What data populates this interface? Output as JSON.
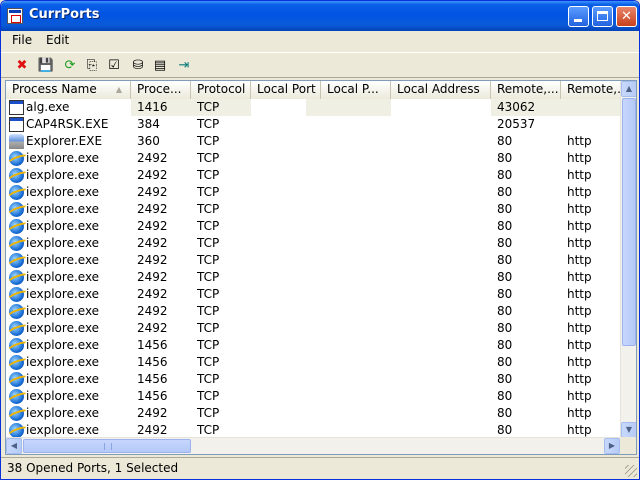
{
  "window": {
    "title": "CurrPorts",
    "app_icon": "currports-app-icon"
  },
  "title_buttons": {
    "minimize": "minimize-icon",
    "maximize": "maximize-icon",
    "close_label": "✕"
  },
  "menu": {
    "file": "File",
    "edit": "Edit"
  },
  "toolbar": {
    "items": [
      {
        "name": "close-connections-button",
        "icon": "red-x-icon",
        "glyph": "✖",
        "color": "#e01010"
      },
      {
        "name": "save-button",
        "icon": "floppy-disk-icon",
        "glyph": "💾",
        "color": "#000000"
      },
      {
        "name": "refresh-button",
        "icon": "refresh-icon",
        "glyph": "⟳",
        "color": "#1a9a1a"
      },
      {
        "name": "copy-button",
        "icon": "copy-icon",
        "glyph": "⎘",
        "color": "#000000"
      },
      {
        "name": "properties-button",
        "icon": "properties-icon",
        "glyph": "☑",
        "color": "#000000"
      },
      {
        "name": "find-button",
        "icon": "binoculars-icon",
        "glyph": "⛁",
        "color": "#000000"
      },
      {
        "name": "html-report-button",
        "icon": "report-icon",
        "glyph": "▤",
        "color": "#000000"
      },
      {
        "name": "exit-button",
        "icon": "exit-icon",
        "glyph": "⇥",
        "color": "#0a7a7a"
      }
    ]
  },
  "columns": [
    {
      "key": "process",
      "label": "Process Name",
      "sorted": true
    },
    {
      "key": "pid",
      "label": "Proce..."
    },
    {
      "key": "protocol",
      "label": "Protocol"
    },
    {
      "key": "local_port",
      "label": "Local Port"
    },
    {
      "key": "local_port_name",
      "label": "Local P..."
    },
    {
      "key": "local_address",
      "label": "Local Address"
    },
    {
      "key": "remote_port",
      "label": "Remote,..."
    },
    {
      "key": "remote_port_name",
      "label": "Remote,..."
    }
  ],
  "rows": [
    {
      "icon": "window",
      "process": "alg.exe",
      "pid": "1416",
      "protocol": "TCP",
      "remote_port": "43062",
      "remote_port_name": "",
      "selected": true
    },
    {
      "icon": "window",
      "process": "CAP4RSK.EXE",
      "pid": "384",
      "protocol": "TCP",
      "remote_port": "20537",
      "remote_port_name": ""
    },
    {
      "icon": "explorer",
      "process": "Explorer.EXE",
      "pid": "360",
      "protocol": "TCP",
      "remote_port": "80",
      "remote_port_name": "http"
    },
    {
      "icon": "ie",
      "process": "iexplore.exe",
      "pid": "2492",
      "protocol": "TCP",
      "remote_port": "80",
      "remote_port_name": "http"
    },
    {
      "icon": "ie",
      "process": "iexplore.exe",
      "pid": "2492",
      "protocol": "TCP",
      "remote_port": "80",
      "remote_port_name": "http"
    },
    {
      "icon": "ie",
      "process": "iexplore.exe",
      "pid": "2492",
      "protocol": "TCP",
      "remote_port": "80",
      "remote_port_name": "http"
    },
    {
      "icon": "ie",
      "process": "iexplore.exe",
      "pid": "2492",
      "protocol": "TCP",
      "remote_port": "80",
      "remote_port_name": "http"
    },
    {
      "icon": "ie",
      "process": "iexplore.exe",
      "pid": "2492",
      "protocol": "TCP",
      "remote_port": "80",
      "remote_port_name": "http"
    },
    {
      "icon": "ie",
      "process": "iexplore.exe",
      "pid": "2492",
      "protocol": "TCP",
      "remote_port": "80",
      "remote_port_name": "http"
    },
    {
      "icon": "ie",
      "process": "iexplore.exe",
      "pid": "2492",
      "protocol": "TCP",
      "remote_port": "80",
      "remote_port_name": "http"
    },
    {
      "icon": "ie",
      "process": "iexplore.exe",
      "pid": "2492",
      "protocol": "TCP",
      "remote_port": "80",
      "remote_port_name": "http"
    },
    {
      "icon": "ie",
      "process": "iexplore.exe",
      "pid": "2492",
      "protocol": "TCP",
      "remote_port": "80",
      "remote_port_name": "http"
    },
    {
      "icon": "ie",
      "process": "iexplore.exe",
      "pid": "2492",
      "protocol": "TCP",
      "remote_port": "80",
      "remote_port_name": "http"
    },
    {
      "icon": "ie",
      "process": "iexplore.exe",
      "pid": "2492",
      "protocol": "TCP",
      "remote_port": "80",
      "remote_port_name": "http"
    },
    {
      "icon": "ie",
      "process": "iexplore.exe",
      "pid": "1456",
      "protocol": "TCP",
      "remote_port": "80",
      "remote_port_name": "http"
    },
    {
      "icon": "ie",
      "process": "iexplore.exe",
      "pid": "1456",
      "protocol": "TCP",
      "remote_port": "80",
      "remote_port_name": "http"
    },
    {
      "icon": "ie",
      "process": "iexplore.exe",
      "pid": "1456",
      "protocol": "TCP",
      "remote_port": "80",
      "remote_port_name": "http"
    },
    {
      "icon": "ie",
      "process": "iexplore.exe",
      "pid": "1456",
      "protocol": "TCP",
      "remote_port": "80",
      "remote_port_name": "http"
    },
    {
      "icon": "ie",
      "process": "iexplore.exe",
      "pid": "2492",
      "protocol": "TCP",
      "remote_port": "80",
      "remote_port_name": "http"
    },
    {
      "icon": "ie",
      "process": "iexplore.exe",
      "pid": "2492",
      "protocol": "TCP",
      "remote_port": "80",
      "remote_port_name": "http"
    }
  ],
  "status": {
    "text": "38 Opened Ports, 1 Selected"
  },
  "colors": {
    "title_bar": "#0054e3",
    "selection": "#f0efe4",
    "list_border": "#7f9db9"
  }
}
